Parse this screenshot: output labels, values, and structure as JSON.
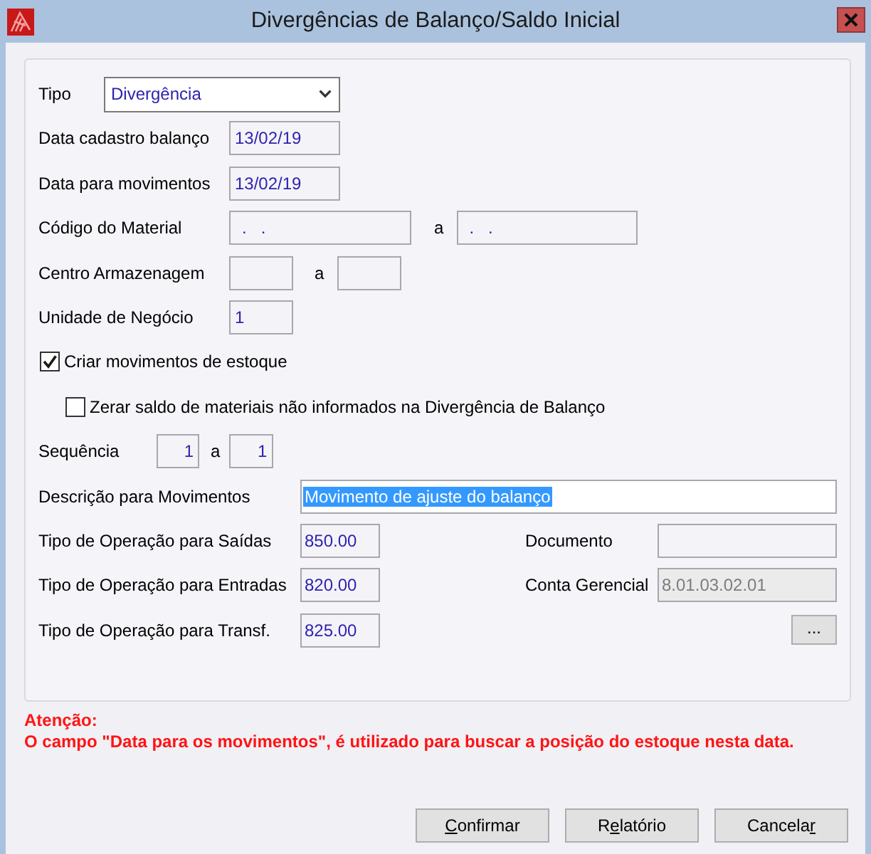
{
  "window": {
    "title": "Divergências de Balanço/Saldo Inicial"
  },
  "form": {
    "tipo": {
      "label": "Tipo",
      "value": "Divergência"
    },
    "data_cadastro": {
      "label": "Data cadastro balanço",
      "value": "13/02/19"
    },
    "data_movimentos": {
      "label": "Data para movimentos",
      "value": "13/02/19"
    },
    "codigo_material": {
      "label": "Código do Material",
      "separator": "a",
      "from": ".   .",
      "to": ".   ."
    },
    "centro_armazenagem": {
      "label": "Centro Armazenagem",
      "separator": "a"
    },
    "unidade_negocio": {
      "label": "Unidade de Negócio",
      "value": "1"
    },
    "checkboxes": [
      {
        "label": "Criar movimentos de estoque",
        "checked": true,
        "children": [
          {
            "label": "Zerar saldo de materiais não informados na Divergência de Balanço",
            "checked": false
          }
        ]
      }
    ],
    "sequencia": {
      "label": "Sequência",
      "separator": "a",
      "from": "1",
      "to": "1"
    },
    "descricao": {
      "label": "Descrição para Movimentos",
      "value": "Movimento de ajuste do balanço",
      "selected": true
    },
    "operacoes": [
      {
        "label": "Tipo de Operação para Saídas",
        "value": "850.00"
      },
      {
        "label": "Tipo de Operação para Entradas",
        "value": "820.00"
      },
      {
        "label": "Tipo de Operação para Transf.",
        "value": "825.00"
      }
    ],
    "side_fields": [
      {
        "label": "Documento",
        "disabled": false
      },
      {
        "label": "Conta Gerencial",
        "value": "8.01.03.02.01",
        "disabled": true
      }
    ],
    "lookup_button": {
      "label": "..."
    }
  },
  "warning": {
    "title": "Atenção:",
    "text": "O campo \"Data para os movimentos\", é utilizado para buscar a posição do estoque nesta data."
  },
  "buttons": [
    {
      "mnemonic": "C",
      "after": "onfirmar"
    },
    {
      "before": "R",
      "mnemonic": "e",
      "after": "latório"
    },
    {
      "before": "Cancela",
      "mnemonic": "r"
    }
  ]
}
